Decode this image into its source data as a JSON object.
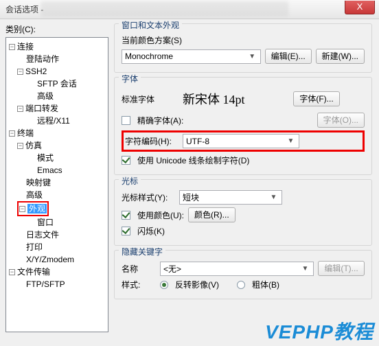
{
  "title": "会话选项 -",
  "close_glyph": "X",
  "left": {
    "label": "类别(C):",
    "tree": {
      "connection": "连接",
      "login_action": "登陆动作",
      "ssh2": "SSH2",
      "sftp_session": "SFTP 会话",
      "advanced": "高级",
      "port_forward": "端口转发",
      "remote_x11": "远程/X11",
      "terminal": "终端",
      "emulation": "仿真",
      "mode": "模式",
      "emacs": "Emacs",
      "map_keys": "映射键",
      "advanced2": "高级",
      "appearance": "外观",
      "window": "窗口",
      "log_file": "日志文件",
      "print": "打印",
      "xyz": "X/Y/Zmodem",
      "file_transfer": "文件传输",
      "ftp_sftp": "FTP/SFTP"
    }
  },
  "right": {
    "g1_title": "窗口和文本外观",
    "scheme_label": "当前颜色方案(S)",
    "scheme_value": "Monochrome",
    "edit_btn": "编辑(E)...",
    "new_btn": "新建(W)...",
    "g2_title": "字体",
    "std_font_label": "标准字体",
    "font_sample": "新宋体  14pt",
    "font_btn": "字体(F)...",
    "exact_font_label": "精确字体(A):",
    "font_btn2": "字体(O)...",
    "encoding_label": "字符编码(H):",
    "encoding_value": "UTF-8",
    "unicode_chk": "使用 Unicode 线条绘制字符(D)",
    "g3_title": "光标",
    "cursor_style_label": "光标样式(Y):",
    "cursor_style_value": "短块",
    "use_color_label": "使用颜色(U):",
    "color_btn": "颜色(R)...",
    "blink_label": "闪烁(K)",
    "g4_title": "隐藏关键字",
    "name_label": "名称",
    "name_value": "<无>",
    "edit_btn2": "编辑(T)...",
    "style_label": "样式:",
    "reverse_label": "反转影像(V)",
    "bold_label": "粗体(B)"
  },
  "watermark": "VEPHP教程"
}
